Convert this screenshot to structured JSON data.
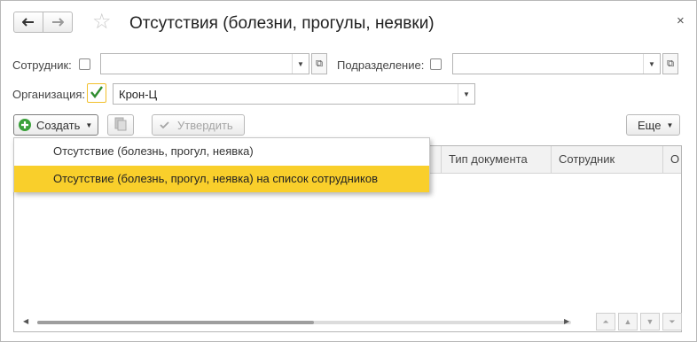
{
  "window": {
    "title": "Отсутствия (болезни, прогулы, неявки)",
    "close_glyph": "×"
  },
  "nav": {
    "back_glyph": "🡐",
    "forward_glyph": "🡒",
    "star_glyph": "☆"
  },
  "filters": {
    "employee_label": "Сотрудник:",
    "employee_value": "",
    "department_label": "Подразделение:",
    "department_value": "",
    "organization_label": "Организация:",
    "organization_checked": true,
    "organization_value": "Крон-Ц"
  },
  "toolbar": {
    "create_label": "Создать",
    "approve_label": "Утвердить",
    "more_label": "Еще"
  },
  "table": {
    "columns": [
      "Тип документа",
      "Сотрудник",
      "О"
    ]
  },
  "create_menu": {
    "items": [
      {
        "label": "Отсутствие (болезнь, прогул, неявка)",
        "highlighted": false
      },
      {
        "label": "Отсутствие (болезнь, прогул, неявка) на список сотрудников",
        "highlighted": true
      }
    ]
  },
  "colors": {
    "accent_highlight": "#f9cf2b",
    "create_icon": "#3aa13a",
    "check_green": "#2f8d2f"
  },
  "icons": {
    "back": "arrow-left-icon",
    "forward": "arrow-right-icon",
    "favorite": "star-icon",
    "close": "close-icon",
    "create": "plus-circle-icon",
    "copy": "copy-document-icon",
    "approve": "checkmark-icon"
  }
}
